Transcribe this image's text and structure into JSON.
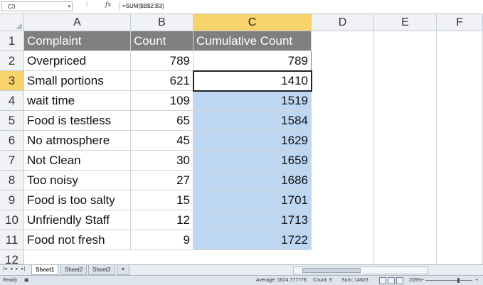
{
  "formula_bar": {
    "name_box": "C3",
    "formula": "=SUM($B$2:B3)"
  },
  "columns": [
    "A",
    "B",
    "C",
    "D",
    "E",
    "F"
  ],
  "rows": [
    "1",
    "2",
    "3",
    "4",
    "5",
    "6",
    "7",
    "8",
    "9",
    "10",
    "11",
    "12"
  ],
  "table": {
    "headers": [
      "Complaint",
      "Count",
      "Cumulative Count"
    ],
    "rows": [
      [
        "Overpriced",
        "789",
        "789"
      ],
      [
        "Small portions",
        "621",
        "1410"
      ],
      [
        "wait time",
        "109",
        "1519"
      ],
      [
        "Food is testless",
        "65",
        "1584"
      ],
      [
        "No atmosphere",
        "45",
        "1629"
      ],
      [
        "Not Clean",
        "30",
        "1659"
      ],
      [
        "Too noisy",
        "27",
        "1686"
      ],
      [
        "Food is too salty",
        "15",
        "1701"
      ],
      [
        "Unfriendly Staff",
        "12",
        "1713"
      ],
      [
        "Food not fresh",
        "9",
        "1722"
      ]
    ]
  },
  "sheet_tabs": [
    "Sheet1",
    "Sheet2",
    "Sheet3"
  ],
  "status": {
    "mode": "Ready",
    "average": "Average: 1624.777778",
    "count": "Count: 9",
    "sum": "Sum: 14623",
    "zoom": "205%"
  },
  "colors": {
    "header_fill": "#7f7f7f",
    "selection_fill": "#bdd7f3",
    "active_header": "#f8d26a"
  }
}
